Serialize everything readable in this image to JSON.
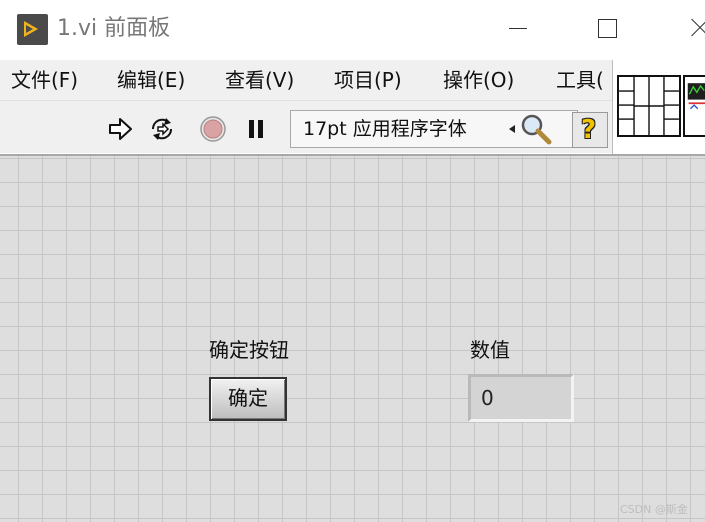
{
  "window": {
    "title": "1.vi 前面板",
    "icons": {
      "app": "labview-run-icon",
      "minimize": "minimize-icon",
      "maximize": "maximize-icon",
      "close": "close-icon"
    }
  },
  "menu": {
    "items": [
      "文件(F)",
      "编辑(E)",
      "查看(V)",
      "项目(P)",
      "操作(O)",
      "工具("
    ]
  },
  "toolbar": {
    "icons": [
      "run-arrow-icon",
      "run-continuously-icon",
      "abort-execution-icon",
      "pause-icon",
      "search-icon",
      "help-icon"
    ],
    "font_selector": "17pt 应用程序字体",
    "help_glyph": "?"
  },
  "front_panel": {
    "button_control": {
      "label": "确定按钮",
      "text": "确定"
    },
    "numeric_indicator": {
      "label": "数值",
      "value": "0"
    },
    "watermark": "CSDN @斯金"
  },
  "colors": {
    "grid_background": "#dedede",
    "grid_line": "#c5c5c5",
    "accent": "#f3b31a"
  }
}
